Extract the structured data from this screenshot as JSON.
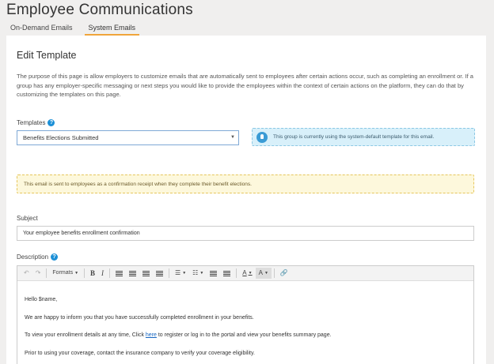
{
  "page": {
    "title": "Employee Communications",
    "tabs": [
      {
        "label": "On-Demand Emails",
        "active": false
      },
      {
        "label": "System Emails",
        "active": true
      }
    ]
  },
  "card": {
    "title": "Edit Template",
    "intro": "The purpose of this page is allow employers to customize emails that are automatically sent to employees after certain actions occur, such as completing an enrollment or. If a group has any employer-specific messaging or next steps you would like to provide the employees within the context of certain actions on the platform, they can do that by customizing the templates on this page."
  },
  "templates": {
    "label": "Templates",
    "selected": "Benefits Elections Submitted",
    "info": "This group is currently using the system-default template for this email."
  },
  "notice": "This email is sent to employees as a confirmation receipt when they complete their benefit elections.",
  "subject": {
    "label": "Subject",
    "value": "Your employee benefits enrollment confirmation"
  },
  "description": {
    "label": "Description",
    "toolbar": {
      "formats_label": "Formats",
      "bold_label": "B",
      "italic_label": "I",
      "text_color_label": "A",
      "bg_color_label": "A"
    },
    "body": {
      "greeting": "Hello $name,",
      "line1": "We are happy to inform you that you have successfully completed enrollment in your benefits.",
      "line2_before": "To view your enrollment details at any time, Click ",
      "line2_link": "here",
      "line2_after": " to register or log in to the portal and view your benefits summary page.",
      "line3": "Prior to using your coverage, contact the insurance company to verify your coverage eligibility."
    }
  },
  "colors": {
    "accent_tab": "#f0a53b",
    "info_bg": "#d8f0fa",
    "warn_bg": "#fdf8dc",
    "help_icon": "#1b8fd6",
    "link": "#1565c0"
  }
}
